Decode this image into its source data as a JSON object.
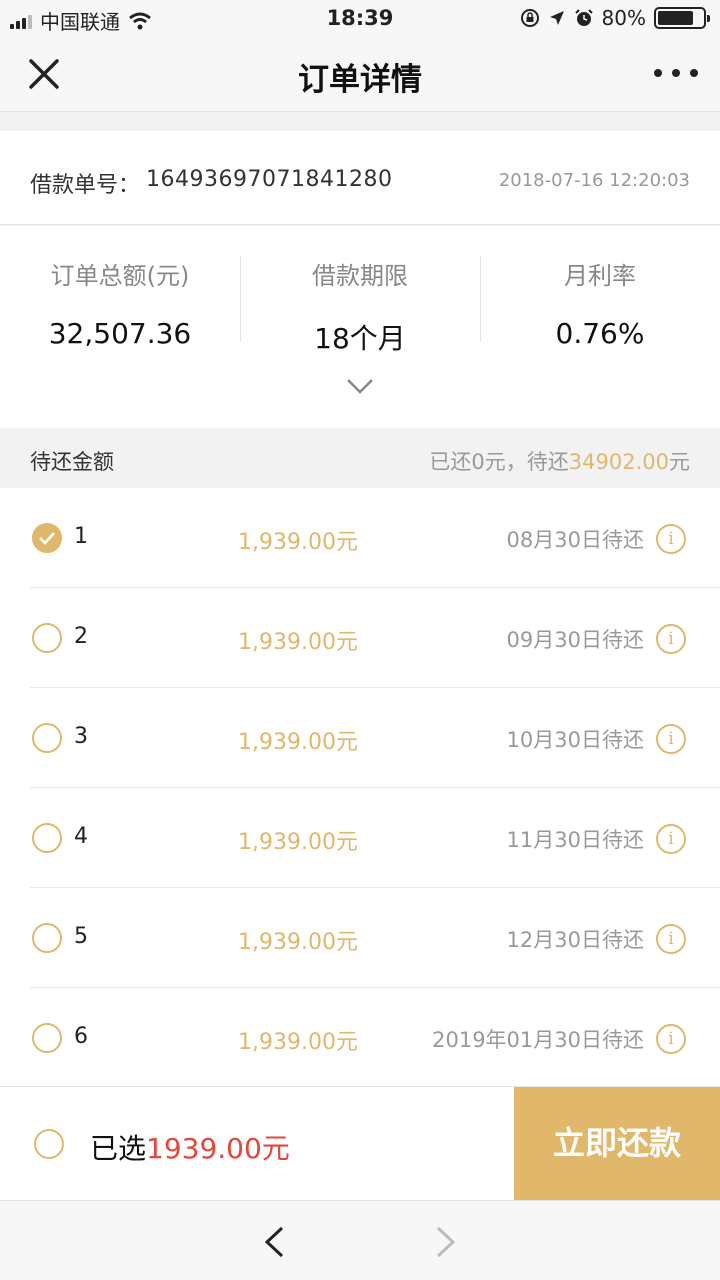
{
  "status_bar": {
    "carrier": "中国联通",
    "time": "18:39",
    "battery": "80%",
    "battery_level": 0.8
  },
  "nav": {
    "title": "订单详情"
  },
  "order": {
    "number_label": "借款单号：",
    "number": "16493697071841280",
    "timestamp": "2018-07-16 12:20:03"
  },
  "stats": [
    {
      "label": "订单总额(元)",
      "value": "32,507.36"
    },
    {
      "label": "借款期限",
      "value": "18个月"
    },
    {
      "label": "月利率",
      "value": "0.76%"
    }
  ],
  "pending": {
    "label": "待还金额",
    "summary_prefix": "已还0元，待还",
    "summary_amount": "34902.00",
    "summary_suffix": "元"
  },
  "installments": [
    {
      "index": "1",
      "amount": "1,939.00元",
      "due": "08月30日待还",
      "selected": true
    },
    {
      "index": "2",
      "amount": "1,939.00元",
      "due": "09月30日待还",
      "selected": false
    },
    {
      "index": "3",
      "amount": "1,939.00元",
      "due": "10月30日待还",
      "selected": false
    },
    {
      "index": "4",
      "amount": "1,939.00元",
      "due": "11月30日待还",
      "selected": false
    },
    {
      "index": "5",
      "amount": "1,939.00元",
      "due": "12月30日待还",
      "selected": false
    },
    {
      "index": "6",
      "amount": "1,939.00元",
      "due": "2019年01月30日待还",
      "selected": false
    }
  ],
  "info_glyph": "i",
  "footer": {
    "selected_label": "已选",
    "selected_amount": "1939.00元",
    "pay_button": "立即还款"
  },
  "colors": {
    "accent_gold": "#e0b76b",
    "amount_red": "#e5473b"
  },
  "icons": [
    "close-icon",
    "more-icon",
    "chevron-down-icon",
    "check-icon",
    "info-icon",
    "back-arrow-icon",
    "forward-arrow-icon"
  ]
}
